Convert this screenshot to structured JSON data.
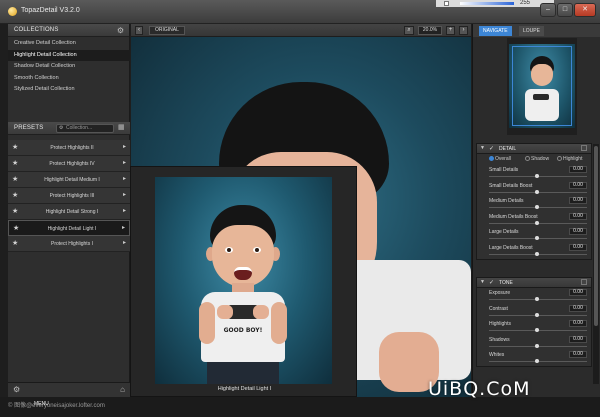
{
  "window": {
    "title": "TopazDetail V3.2.0",
    "topright_value": "255"
  },
  "collections": {
    "header": "COLLECTIONS",
    "items": [
      "Creative Detail Collection",
      "Highlight Detail Collection",
      "Shadow Detail Collection",
      "Smooth Collection",
      "Stylized Detail Collection"
    ],
    "selected_index": 1
  },
  "presets": {
    "header": "PRESETS",
    "dropdown_placeholder": "Collection...",
    "items": [
      "Protect Highlights II",
      "Protect Highlights IV",
      "Highlight Detail Medium I",
      "Protect Highlights III",
      "Highlight Detail Strong I",
      "Highlight Detail Light I",
      "Protect Highlights I"
    ],
    "selected_index": 5
  },
  "toolbar": {
    "original_label": "ORIGINAL",
    "zoom": "20.0%"
  },
  "preview": {
    "caption": "Highlight Detail Light I",
    "shirt_text": "GOOD BOY!"
  },
  "navigator": {
    "tab_navigate": "NAVIGATE",
    "tab_loupe": "LOUPE",
    "active_tab": "NAVIGATE"
  },
  "detail": {
    "header": "DETAIL",
    "modes": [
      "Overall",
      "Shadow",
      "Highlight"
    ],
    "active_mode": "Overall",
    "rows": [
      {
        "label": "Small Details",
        "value": "0.00"
      },
      {
        "label": "Small Details Boost",
        "value": "0.00"
      },
      {
        "label": "Medium Details",
        "value": "0.00"
      },
      {
        "label": "Medium Details Boost",
        "value": "0.00"
      },
      {
        "label": "Large Details",
        "value": "0.00"
      },
      {
        "label": "Large Details Boost",
        "value": "0.00"
      }
    ]
  },
  "tone": {
    "header": "TONE",
    "rows": [
      {
        "label": "Exposure",
        "value": "0.00"
      },
      {
        "label": "Contrast",
        "value": "0.00"
      },
      {
        "label": "Highlights",
        "value": "0.00"
      },
      {
        "label": "Shadows",
        "value": "0.00"
      },
      {
        "label": "Whites",
        "value": "0.00"
      }
    ]
  },
  "statusbar": {
    "menu_label": "MENU",
    "meta": "© 图像@everyoneisajoker.lofter.com"
  },
  "watermark": "UiBQ.CoM",
  "colors": {
    "accent": "#3d86d6",
    "panel": "#2e2e2e",
    "canvas": "#1d4b5e"
  },
  "icons": {
    "app": "topaz-logo-icon",
    "settings": "gear-icon",
    "preset_star": "star-icon",
    "expand": "chevron-right-icon",
    "grid": "grid-icon",
    "zoom": "magnifier-icon"
  }
}
